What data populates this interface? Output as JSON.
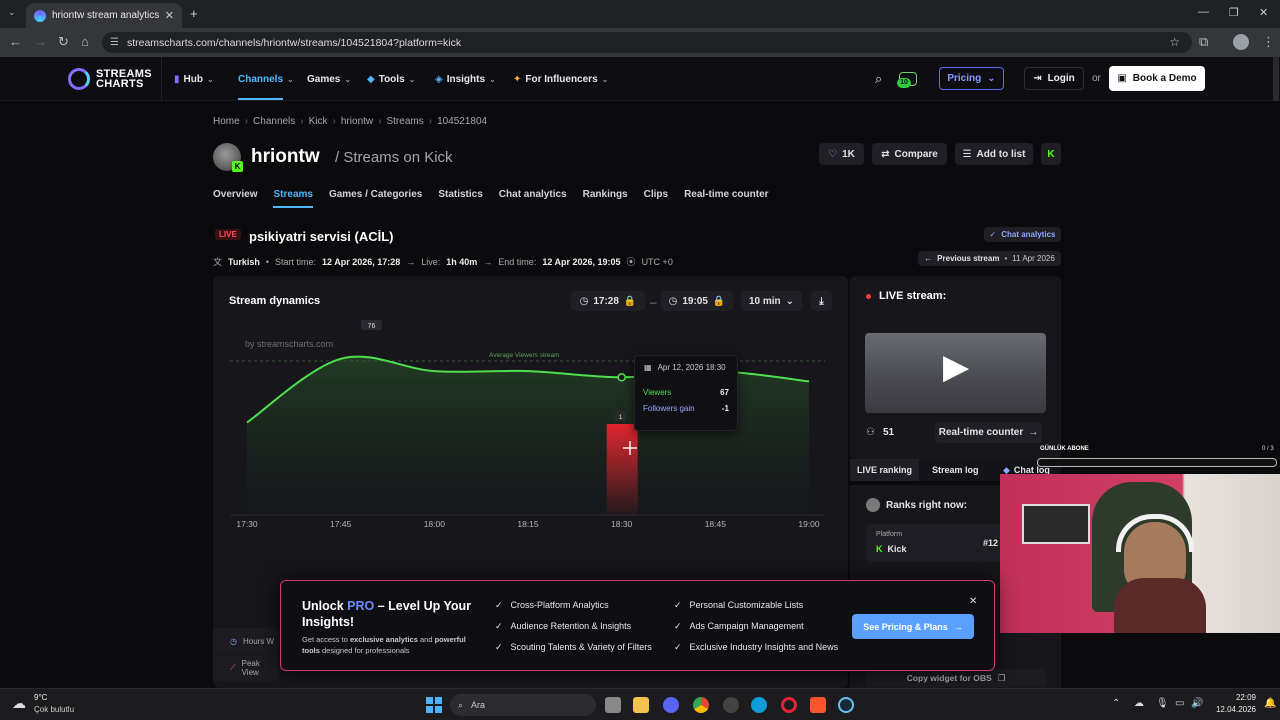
{
  "browser": {
    "tab_title": "hriontw stream analytics & stat",
    "url": "streamscharts.com/channels/hriontw/streams/104521804?platform=kick"
  },
  "header": {
    "logo_line1": "STREAMS",
    "logo_line2": "CHARTS",
    "nav": [
      "Hub",
      "Channels",
      "Games",
      "Tools",
      "Insights",
      "For Influencers"
    ],
    "notif_count": "10",
    "pricing": "Pricing",
    "login": "Login",
    "or": "or",
    "book_demo": "Book a Demo"
  },
  "breadcrumb": [
    "Home",
    "Channels",
    "Kick",
    "hriontw",
    "Streams",
    "104521804"
  ],
  "channel": {
    "name": "hriontw",
    "subtitle": "/ Streams on Kick",
    "likes": "1K",
    "compare": "Compare",
    "add_to_list": "Add to list"
  },
  "tabs": [
    "Overview",
    "Streams",
    "Games / Categories",
    "Statistics",
    "Chat analytics",
    "Rankings",
    "Clips",
    "Real-time counter"
  ],
  "stream": {
    "live_badge": "LIVE",
    "title": "psikiyatri servisi (ACİL)",
    "language": "Turkish",
    "start_label": "Start time:",
    "start_value": "12 Apr 2026, 17:28",
    "live_label": "Live:",
    "live_value": "1h 40m",
    "end_label": "End time:",
    "end_value": "12 Apr 2026, 19:05",
    "timezone": "UTC +0",
    "chat_analytics_btn": "Chat analytics",
    "prev_stream_label": "Previous stream",
    "prev_stream_date": "11 Apr 2026"
  },
  "dynamics": {
    "title": "Stream dynamics",
    "from": "17:28",
    "dash": "–",
    "to": "19:05",
    "interval": "10 min",
    "watermark": "by streamscharts.com",
    "avg_label": "Average Viewers stream",
    "peak_label": "76",
    "followers_bar_label": "1",
    "tooltip": {
      "date": "Apr 12, 2026 18:30",
      "viewers_label": "Viewers",
      "viewers_value": "67",
      "followers_label": "Followers gain",
      "followers_value": "-1"
    }
  },
  "chart_data": {
    "type": "line",
    "x": [
      "17:30",
      "17:45",
      "18:00",
      "18:15",
      "18:30",
      "18:45",
      "19:00"
    ],
    "series": [
      {
        "name": "Viewers",
        "values": [
          45,
          76,
          70,
          70,
          67,
          70,
          65
        ]
      }
    ],
    "bar_series": {
      "name": "Followers gain",
      "x": "18:30",
      "value": 1
    },
    "ylim": [
      0,
      90
    ],
    "grid": false
  },
  "live_panel": {
    "title": "LIVE stream:",
    "viewers": "51",
    "realtime_btn": "Real-time counter",
    "tabs": [
      "LIVE ranking",
      "Stream log",
      "Chat log"
    ],
    "ranks_title": "Ranks right now:",
    "platform_label": "Platform",
    "platform_value": "Kick",
    "rank_value": "#12",
    "copy_widget": "Copy widget for OBS"
  },
  "overlay": {
    "abone_label": "GÜNLÜK ABONE",
    "abone_count": "0 / 3"
  },
  "promo": {
    "title_pre": "Unlock ",
    "title_pro": "PRO",
    "title_post": " – Level Up Your Insights!",
    "desc_1": "Get access to ",
    "desc_b1": "exclusive analytics",
    "desc_2": " and ",
    "desc_b2": "powerful tools",
    "desc_3": " designed for professionals",
    "features": [
      "Cross-Platform Analytics",
      "Audience Retention & Insights",
      "Scouting Talents & Variety of Filters",
      "Personal Customizable Lists",
      "Ads Campaign Management",
      "Exclusive Industry Insights and News"
    ],
    "cta": "See Pricing & Plans"
  },
  "partial_rows": [
    "Hours W",
    "Peak View"
  ],
  "taskbar": {
    "temp": "9°C",
    "weather": "Çok bulutlu",
    "search": "Ara",
    "time": "22:09",
    "date": "12.04.2026"
  }
}
